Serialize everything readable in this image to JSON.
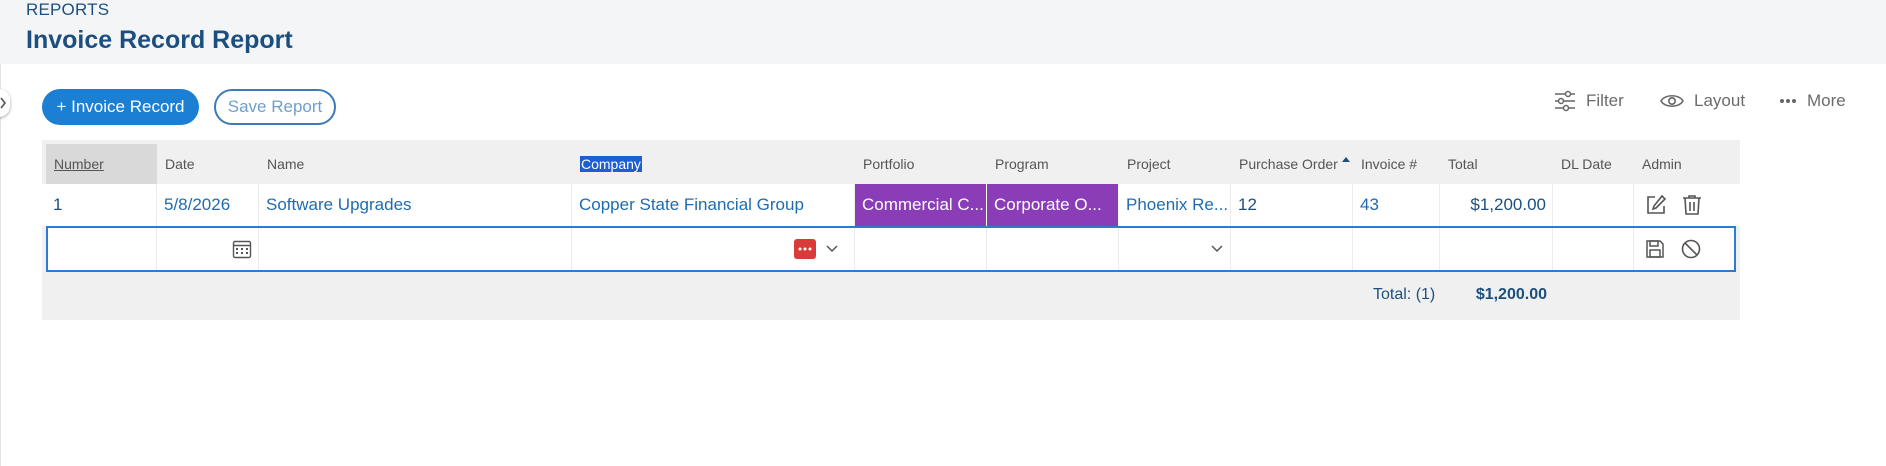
{
  "header": {
    "breadcrumb": "REPORTS",
    "title": "Invoice Record Report"
  },
  "toolbar": {
    "add_label": "+ Invoice Record",
    "save_label": "Save Report",
    "filter_label": "Filter",
    "layout_label": "Layout",
    "more_label": "More"
  },
  "columns": [
    "Number",
    "Date",
    "Name",
    "Company",
    "Portfolio",
    "Program",
    "Project",
    "Purchase Order",
    "Invoice #",
    "Total",
    "DL Date",
    "Admin"
  ],
  "rows": [
    {
      "number": "1",
      "date": "5/8/2026",
      "name": "Software Upgrades",
      "company": "Copper State Financial Group",
      "portfolio": "Commercial C...",
      "program": "Corporate O...",
      "project": "Phoenix Re...",
      "purchase_order": "12",
      "invoice_no": "43",
      "total": "$1,200.00",
      "dl_date": ""
    }
  ],
  "footer": {
    "count_label": "Total: (1)",
    "sum": "$1,200.00"
  },
  "colors": {
    "accent": "#1b7fd4",
    "title": "#1c4f80",
    "tag_purple": "#8b3db8",
    "selection": "#1d5fd1",
    "badge_red": "#d93a3a"
  },
  "icons": [
    "chevron-right-icon",
    "sliders-icon",
    "eye-icon",
    "ellipsis-icon",
    "edit-icon",
    "trash-icon",
    "calendar-icon",
    "more-badge-icon",
    "chevron-down-icon",
    "save-icon",
    "cancel-icon"
  ]
}
